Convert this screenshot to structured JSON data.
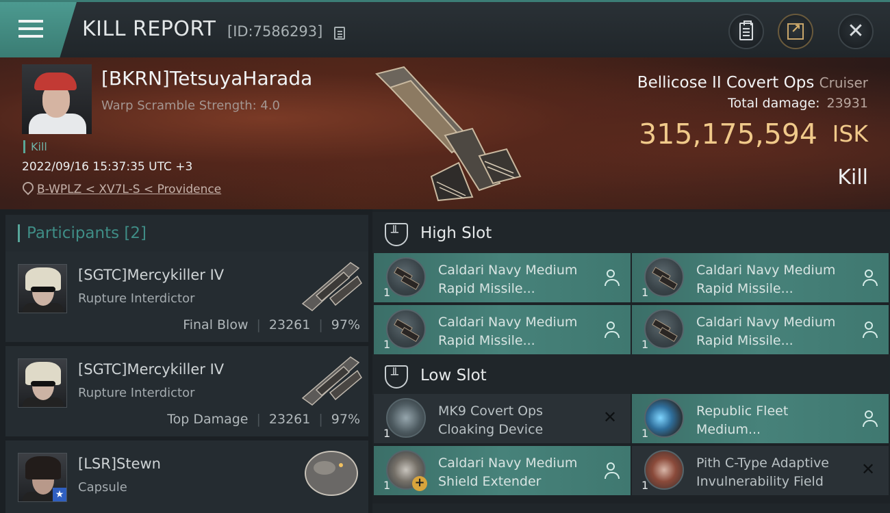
{
  "titlebar": {
    "title": "KILL REPORT",
    "report_id": "[ID:7586293]"
  },
  "victim": {
    "name": "[BKRN]TetsuyaHarada",
    "scramble": "Warp Scramble Strength: 4.0",
    "tag": "Kill",
    "time": "2022/09/16 15:37:35 UTC +3",
    "location": "B-WPLZ < XV7L-S < Providence",
    "ship_name": "Bellicose II Covert Ops",
    "ship_class": "Cruiser",
    "total_damage_label": "Total damage:",
    "total_damage": "23931",
    "isk_value": "315,175,594",
    "isk_unit": "ISK",
    "result": "Kill"
  },
  "participants": {
    "title": "Participants",
    "count": "[2]",
    "rows": [
      {
        "name": "[SGTC]Mercykiller IV",
        "ship": "Rupture Interdictor",
        "label": "Final Blow",
        "damage": "23261",
        "percent": "97%"
      },
      {
        "name": "[SGTC]Mercykiller IV",
        "ship": "Rupture Interdictor",
        "label": "Top Damage",
        "damage": "23261",
        "percent": "97%"
      },
      {
        "name": "[LSR]Stewn",
        "ship": "Capsule"
      }
    ]
  },
  "fitting": {
    "high_slot": "High Slot",
    "low_slot": "Low Slot",
    "high_modules": [
      {
        "line1": "Caldari Navy Medium",
        "line2": "Rapid Missile...",
        "qty": "1"
      },
      {
        "line1": "Caldari Navy Medium",
        "line2": "Rapid Missile...",
        "qty": "1"
      },
      {
        "line1": "Caldari Navy Medium",
        "line2": "Rapid Missile...",
        "qty": "1"
      },
      {
        "line1": "Caldari Navy Medium",
        "line2": "Rapid Missile...",
        "qty": "1"
      }
    ],
    "low_modules": [
      {
        "line1": "MK9 Covert Ops",
        "line2": "Cloaking Device",
        "qty": "1"
      },
      {
        "line1": "Republic Fleet",
        "line2": "Medium...",
        "qty": "1"
      },
      {
        "line1": "Caldari Navy Medium",
        "line2": "Shield Extender",
        "qty": "1"
      },
      {
        "line1": "Pith C-Type Adaptive",
        "line2": "Invulnerability Field",
        "qty": "1"
      }
    ]
  },
  "colors": {
    "accent": "#3f8d86",
    "isk": "#f0c98a",
    "module_dropped": "#47827a",
    "module_destroyed": "#2a3136"
  }
}
